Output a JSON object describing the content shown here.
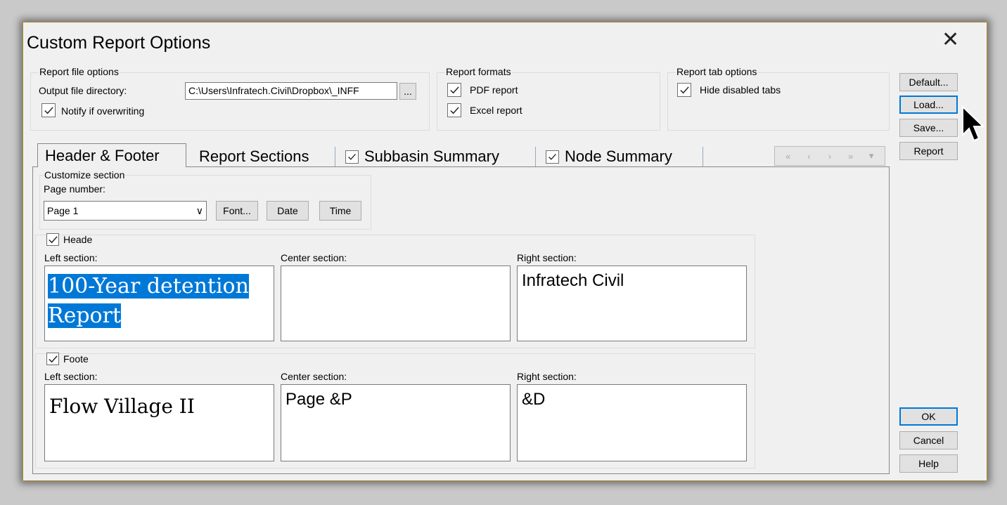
{
  "dialog": {
    "title": "Custom Report Options"
  },
  "file_options": {
    "group_label": "Report file options",
    "dir_label": "Output file directory:",
    "dir_value": "C:\\Users\\Infratech.Civil\\Dropbox\\_INFF",
    "browse_label": "...",
    "notify_label": "Notify if overwriting"
  },
  "formats": {
    "group_label": "Report formats",
    "pdf_label": "PDF report",
    "excel_label": "Excel report"
  },
  "tab_options": {
    "group_label": "Report tab options",
    "hide_label": "Hide disabled tabs"
  },
  "side_buttons": {
    "default": "Default...",
    "load": "Load...",
    "save": "Save...",
    "report": "Report",
    "ok": "OK",
    "cancel": "Cancel",
    "help": "Help"
  },
  "tabs": {
    "header_footer": "Header & Footer",
    "report_sections": "Report Sections",
    "subbasin": "Subbasin Summary",
    "node": "Node Summary"
  },
  "customize": {
    "group_label": "Customize section",
    "page_number_label": "Page number:",
    "page_number_value": "Page 1",
    "font_button": "Font...",
    "date_button": "Date",
    "time_button": "Time"
  },
  "header": {
    "label": "Heade",
    "left_label": "Left section:",
    "center_label": "Center section:",
    "right_label": "Right section:",
    "left_line1": "100-Year detention",
    "left_line2": "Report",
    "center_value": "",
    "right_value": "Infratech Civil"
  },
  "footer": {
    "label": "Foote",
    "left_label": "Left section:",
    "center_label": "Center section:",
    "right_label": "Right section:",
    "left_value": "Flow Village II",
    "center_value": "Page &P",
    "right_value": "&D"
  },
  "colors": {
    "accent": "#0078d7",
    "dialog_border": "#b08a2e"
  }
}
